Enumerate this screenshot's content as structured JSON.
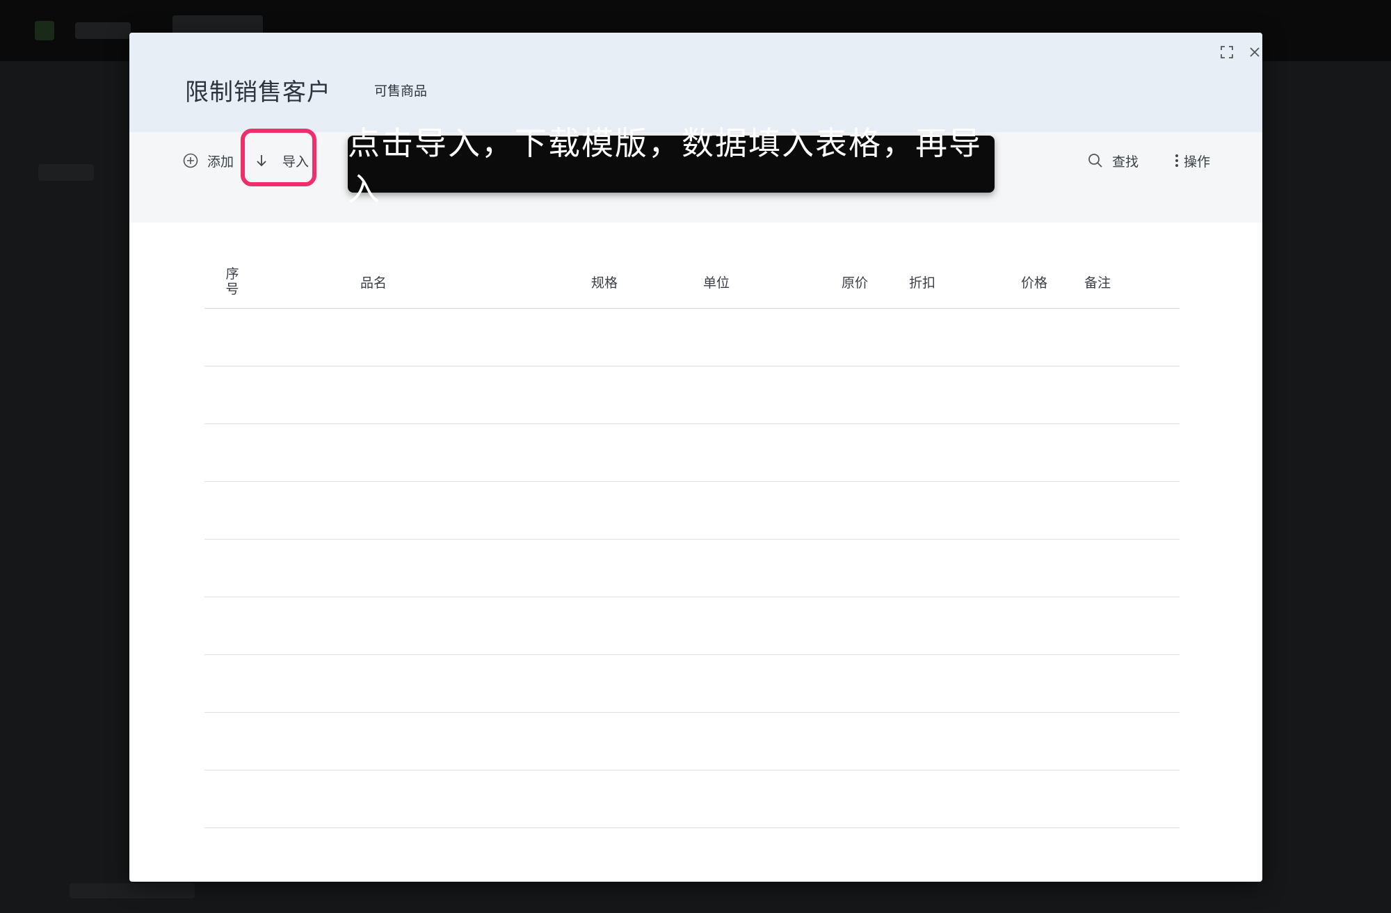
{
  "modal": {
    "title": "限制销售客户",
    "tab": "可售商品"
  },
  "toolbar": {
    "add_label": "添加",
    "import_label": "导入",
    "search_label": "查找",
    "actions_label": "操作"
  },
  "tooltip": {
    "text": "点击导入，下载模版，数据填入表格，再导入"
  },
  "table": {
    "columns": [
      "序\n号",
      "品名",
      "规格",
      "单位",
      "原价",
      "折扣",
      "价格",
      "备注"
    ],
    "row_count": 9
  },
  "colors": {
    "highlight": "#ee2f6c",
    "header_bg": "#e8eef5",
    "toolbar_bg": "#f5f6f7"
  }
}
